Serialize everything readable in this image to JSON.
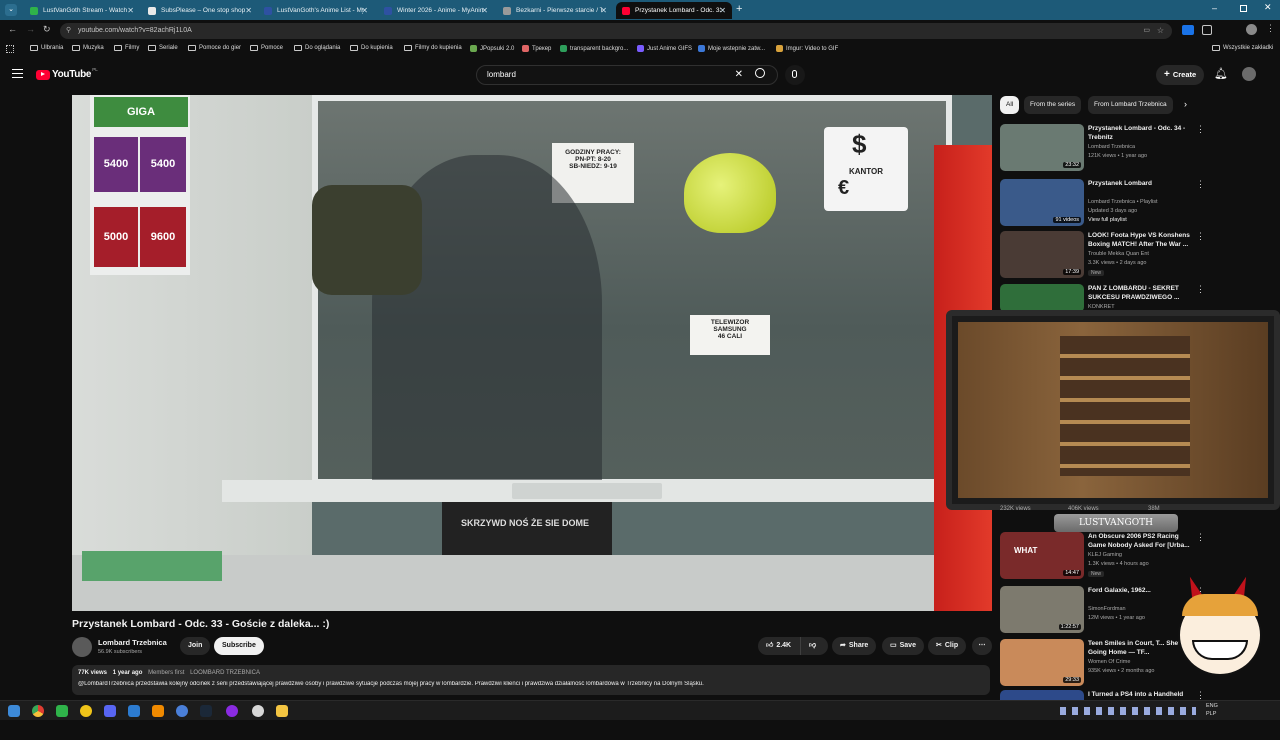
{
  "browser": {
    "tabs": [
      {
        "label": "LustVanGoth Stream - Watch L",
        "color": "#2fb34a",
        "active": false
      },
      {
        "label": "SubsPlease – One stop shop fo",
        "color": "#e9e9e9",
        "active": false
      },
      {
        "label": "LustVanGoth's Anime List - My",
        "color": "#2e51a2",
        "active": false
      },
      {
        "label": "Winter 2026 - Anime - MyAnim",
        "color": "#2e51a2",
        "active": false
      },
      {
        "label": "Bezkarni - Pierwsze starcie / Th",
        "color": "#9a9a9a",
        "active": false
      },
      {
        "label": "Przystanek Lombard - Odc. 33",
        "color": "#ff0033",
        "active": true
      }
    ],
    "new_tab": "+",
    "url": "youtube.com/watch?v=82achRj1L0A",
    "bookmarks": [
      {
        "label": "Ulbrania",
        "kind": "folder"
      },
      {
        "label": "Muzyka",
        "kind": "folder"
      },
      {
        "label": "Filmy",
        "kind": "folder"
      },
      {
        "label": "Seriale",
        "kind": "folder"
      },
      {
        "label": "Pomoce do gier",
        "kind": "folder"
      },
      {
        "label": "Pomoce",
        "kind": "folder"
      },
      {
        "label": "Do oglądania",
        "kind": "folder"
      },
      {
        "label": "Do kupienia",
        "kind": "folder"
      },
      {
        "label": "Filmy do kupienia",
        "kind": "folder"
      },
      {
        "label": "JPopsuki 2.0",
        "kind": "site"
      },
      {
        "label": "Трекер",
        "kind": "site"
      },
      {
        "label": "transparent backgro...",
        "kind": "site"
      },
      {
        "label": "Just Anime GIFS",
        "kind": "site"
      },
      {
        "label": "Moje wstepnie zatw...",
        "kind": "site"
      },
      {
        "label": "Imgur: Video to GIF",
        "kind": "site"
      }
    ],
    "all_bookmarks": "Wszystkie zakładki"
  },
  "youtube": {
    "logo": "YouTube",
    "logo_sup": "PL",
    "search_value": "lombard",
    "create_label": "Create"
  },
  "video": {
    "sign_hours": "GODZINY PRACY:\nPN-PT: 8-20\nSB-NIEDZ: 9-19",
    "sign_kantor": "KANTOR",
    "sign_tv": "TELEWIZOR\nSAMSUNG\n46 CALI",
    "promo": [
      "GIGA",
      "5400",
      "5400",
      "5000",
      "9600"
    ],
    "shirt": "SKRZYWD NOŚ ŻE SIE DOME"
  },
  "watch": {
    "title": "Przystanek Lombard - Odc. 33 - Goście z daleka... :)",
    "channel": "Lombard Trzebnica",
    "subscribers": "56.9K subscribers",
    "join": "Join",
    "subscribe": "Subscribe",
    "likes": "2.4K",
    "share": "Share",
    "save": "Save",
    "clip": "Clip",
    "views": "77K views",
    "age": "1 year ago",
    "members": "Members first",
    "tag": "LOOMBARD TRZEBNICA",
    "description": "@LombardTrzebnica przedstawia kolejny odcinek z serii przedstawiającej prawdziwe osoby i prawdziwe sytuacje podczas mojej pracy w lombardzie. Prawdziwi klienci i prawdziwa działalność lombardowa w Trzebnicy na Dolnym Śląsku."
  },
  "sidebar": {
    "chips": [
      "All",
      "From the series",
      "From Lombard Trzebnica"
    ],
    "recs": [
      {
        "title": "Przystanek Lombard - Odc. 34 - Trebnitz",
        "channel": "Lombard Trzebnica",
        "meta": "121K views • 1 year ago",
        "duration": "23:32",
        "badge": "",
        "thumb": "#6a7a72"
      },
      {
        "title": "Przystanek Lombard",
        "channel": "Lombard Trzebnica • Playlist",
        "meta": "Updated 3 days ago",
        "extra": "View full playlist",
        "duration": "91 videos",
        "badge": "",
        "thumb": "#3a5a8a"
      },
      {
        "title": "LOOK! Foota Hype VS Konshens Boxing MATCH! After The War ...",
        "channel": "Trouble Mekka Quan Ent",
        "meta": "3.3K views • 2 days ago",
        "duration": "17:39",
        "badge": "New",
        "thumb": "#4a3b35"
      },
      {
        "title": "PAN Z LOMBARDU - SEKRET SUKCESU PRAWDZIWEGO ...",
        "channel": "KONKRET",
        "meta": "",
        "duration": "",
        "badge": "",
        "thumb": "#2f6e3a"
      },
      {
        "title": "An Obscure 2006 PS2 Racing Game Nobody Asked For [Urba...",
        "channel": "KLEJ Gaming",
        "meta": "1.3K views • 4 hours ago",
        "duration": "14:47",
        "badge": "New",
        "thumb": "#7a2a2a"
      },
      {
        "title": "Ford Galaxie, 1962...",
        "channel": "SimonFordman",
        "meta": "12M views • 1 year ago",
        "duration": "1:22:57",
        "badge": "",
        "thumb": "#7d7a6e"
      },
      {
        "title": "Teen Smiles in Court, T... She's Going Home — TF...",
        "channel": "Women Of Crime",
        "meta": "935K views • 2 months ago",
        "duration": "29:33",
        "badge": "",
        "thumb": "#c98a5a"
      },
      {
        "title": "I Turned a PS4 into a Handheld",
        "channel": "",
        "meta": "",
        "duration": "",
        "badge": "",
        "thumb": "#2d4a8a"
      }
    ],
    "hidden_views": [
      "232K views",
      "406K views",
      "38M"
    ],
    "overlay_name": "LUSTVANGOTH",
    "what_label": "WHAT"
  },
  "taskbar": {
    "lang": "ENG",
    "region": "PLP"
  }
}
